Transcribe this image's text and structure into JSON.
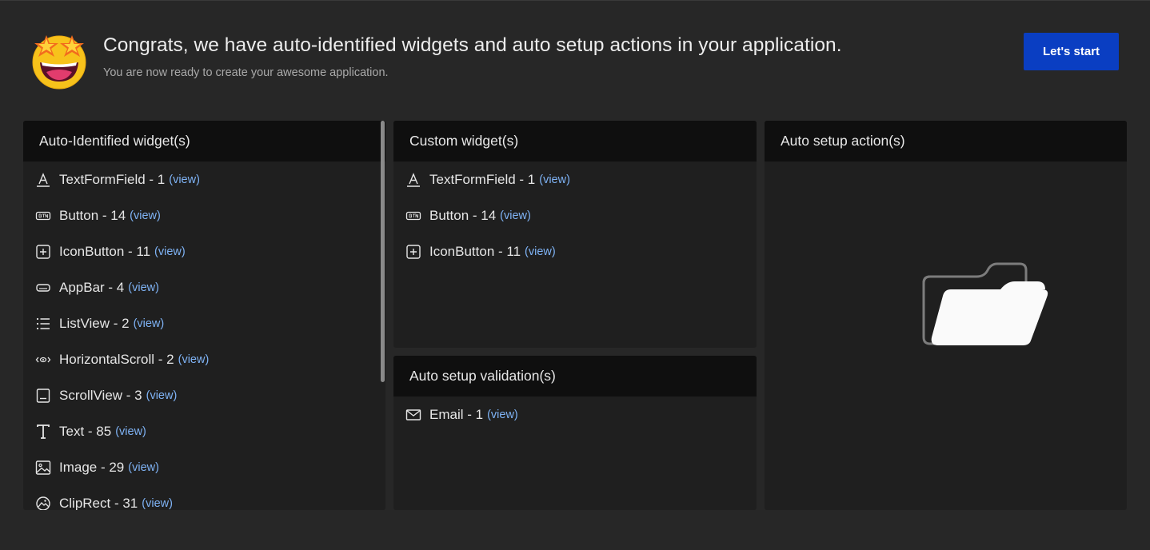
{
  "header": {
    "title": "Congrats, we have auto-identified widgets and auto setup actions in your application.",
    "subtitle": "You are now ready to create your awesome application.",
    "start_label": "Let's start",
    "emoji_icon": "star-struck-emoji-icon"
  },
  "colors": {
    "background": "#272727",
    "panel": "#1f1f1f",
    "panel_header": "#0f0f0f",
    "accent_button": "#0a3ec2",
    "link": "#7fb3f5"
  },
  "auto_identified": {
    "title": "Auto-Identified widget(s)",
    "items": [
      {
        "label": "TextFormField - 1",
        "link": "(view)",
        "icon": "text-field-icon"
      },
      {
        "label": "Button - 14",
        "link": "(view)",
        "icon": "button-icon"
      },
      {
        "label": "IconButton - 11",
        "link": "(view)",
        "icon": "plus-box-icon"
      },
      {
        "label": "AppBar - 4",
        "link": "(view)",
        "icon": "app-bar-icon"
      },
      {
        "label": "ListView - 2",
        "link": "(view)",
        "icon": "list-icon"
      },
      {
        "label": "HorizontalScroll - 2",
        "link": "(view)",
        "icon": "horizontal-scroll-icon"
      },
      {
        "label": "ScrollView - 3",
        "link": "(view)",
        "icon": "scroll-view-icon"
      },
      {
        "label": "Text - 85",
        "link": "(view)",
        "icon": "text-icon"
      },
      {
        "label": "Image - 29",
        "link": "(view)",
        "icon": "image-icon"
      },
      {
        "label": "ClipRect - 31",
        "link": "(view)",
        "icon": "clip-rect-icon"
      }
    ]
  },
  "custom": {
    "title": "Custom widget(s)",
    "items": [
      {
        "label": "TextFormField - 1",
        "link": "(view)",
        "icon": "text-field-icon"
      },
      {
        "label": "Button - 14",
        "link": "(view)",
        "icon": "button-icon"
      },
      {
        "label": "IconButton - 11",
        "link": "(view)",
        "icon": "plus-box-icon"
      }
    ]
  },
  "validation": {
    "title": "Auto setup validation(s)",
    "items": [
      {
        "label": "Email - 1",
        "link": "(view)",
        "icon": "mail-icon"
      }
    ]
  },
  "actions": {
    "title": "Auto setup action(s)",
    "empty_icon": "empty-folder-icon"
  }
}
